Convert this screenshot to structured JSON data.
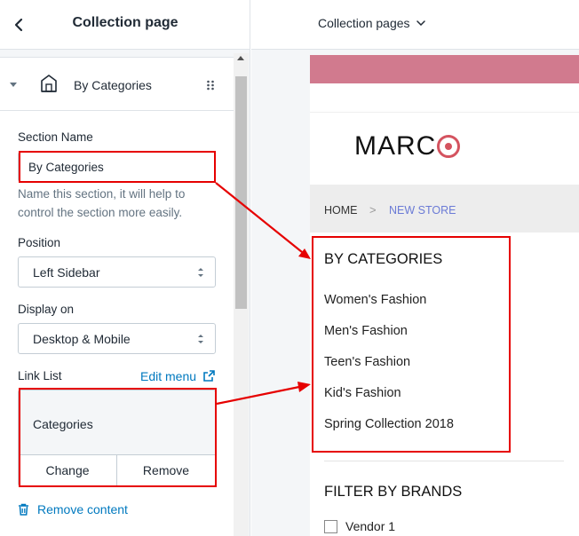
{
  "panel": {
    "title": "Collection page",
    "section": {
      "label": "By Categories"
    },
    "section_name": {
      "label": "Section Name",
      "value": "By Categories",
      "help": "Name this section, it will help to control the section more easily."
    },
    "position": {
      "label": "Position",
      "value": "Left Sidebar"
    },
    "display_on": {
      "label": "Display on",
      "value": "Desktop & Mobile"
    },
    "link_list": {
      "label": "Link List",
      "edit_label": "Edit menu",
      "selected": "Categories",
      "change_label": "Change",
      "remove_label": "Remove"
    },
    "remove_content": "Remove content"
  },
  "preview": {
    "page_select": "Collection pages",
    "logo_text": "MARC",
    "breadcrumb": {
      "home": "HOME",
      "separator": ">",
      "current": "NEW STORE"
    },
    "categories": {
      "heading": "BY CATEGORIES",
      "items": [
        "Women's Fashion",
        "Men's Fashion",
        "Teen's Fashion",
        "Kid's Fashion",
        "Spring Collection 2018"
      ]
    },
    "brands": {
      "heading": "FILTER BY BRANDS",
      "vendor": "Vendor 1"
    }
  },
  "colors": {
    "accent": "#0079bf",
    "annotation": "#e60000",
    "promo_bar": "#d17a8e",
    "logo_mark": "#d4535f",
    "breadcrumb_link": "#6b7bd6"
  },
  "icons": [
    "chevron-left-icon",
    "section-icon",
    "drag-handle-icon",
    "caret-down-icon",
    "select-arrows-icon",
    "external-link-icon",
    "trash-icon",
    "chevron-down-icon"
  ]
}
